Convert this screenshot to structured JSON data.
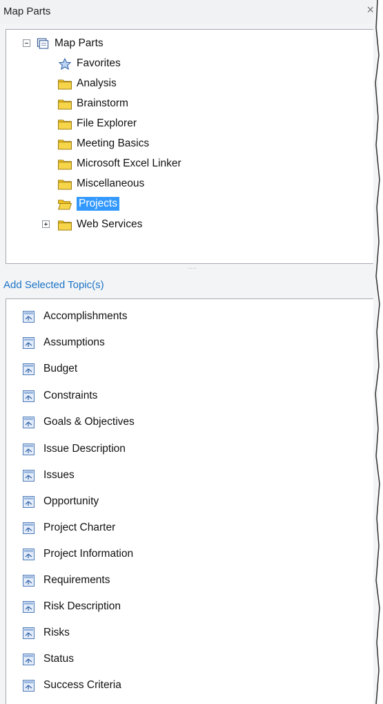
{
  "panel": {
    "title": "Map Parts",
    "close_glyph": "×"
  },
  "tree": {
    "root": {
      "label": "Map Parts",
      "expanded": true,
      "icon": "library-icon"
    },
    "children": [
      {
        "label": "Favorites",
        "icon": "star-icon"
      },
      {
        "label": "Analysis",
        "icon": "folder-icon"
      },
      {
        "label": "Brainstorm",
        "icon": "folder-icon"
      },
      {
        "label": "File Explorer",
        "icon": "folder-icon"
      },
      {
        "label": "Meeting Basics",
        "icon": "folder-icon"
      },
      {
        "label": "Microsoft Excel Linker",
        "icon": "folder-icon"
      },
      {
        "label": "Miscellaneous",
        "icon": "folder-icon"
      },
      {
        "label": "Projects",
        "icon": "open-folder-icon",
        "selected": true
      },
      {
        "label": "Web Services",
        "icon": "folder-icon",
        "expandable": true
      }
    ]
  },
  "add_selected_label": "Add Selected Topic(s)",
  "topics": [
    "Accomplishments",
    "Assumptions",
    "Budget",
    "Constraints",
    "Goals & Objectives",
    "Issue Description",
    "Issues",
    "Opportunity",
    "Project Charter",
    "Project Information",
    "Requirements",
    "Risk Description",
    "Risks",
    "Status",
    "Success Criteria"
  ],
  "colors": {
    "selection": "#3399ff",
    "link": "#1a73c7",
    "folder": "#f2c21a"
  }
}
